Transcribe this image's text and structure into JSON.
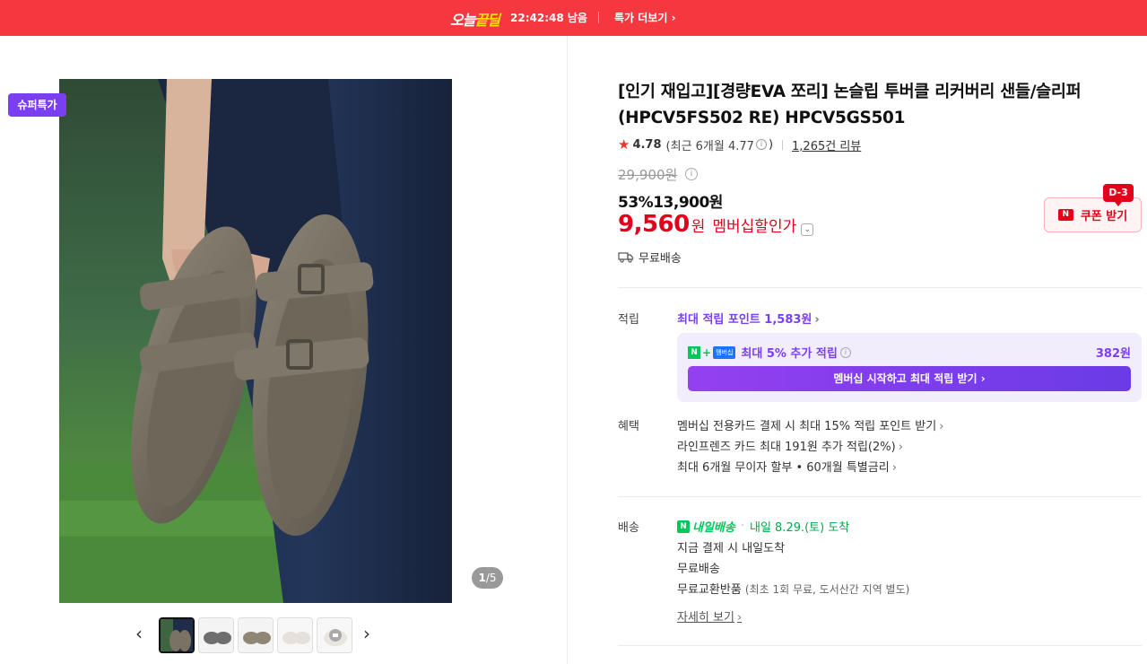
{
  "promo_bar": {
    "logo_white": "오늘",
    "logo_yellow": "끝딜",
    "countdown": "22:42:48",
    "countdown_suffix": "남음",
    "more_link": "특가 더보기"
  },
  "gallery": {
    "badge": "슈퍼특가",
    "pager_current": "1",
    "pager_total": "/5",
    "thumbnail_count": 5,
    "selected_thumbnail": 1
  },
  "product": {
    "title": "[인기 재입고][경량EVA 쪼리] 논슬립 투버클 리커버리 샌들/슬리퍼 (HPCV5FS502 RE) HPCV5GS501",
    "rating": "4.78",
    "recent_rating_label": "(최근 6개월 4.77",
    "recent_rating_close": ")",
    "reviews": "1,265건 리뷰",
    "original_price": "29,900원",
    "discount_rate": "53%",
    "sale_price": "13,900원",
    "member_price": "9,560",
    "member_price_unit": "원",
    "member_price_label": "멤버십할인가",
    "shipping_free": "무료배송"
  },
  "coupon": {
    "badge": "D-3",
    "n_mark": "N",
    "label": "쿠폰 받기"
  },
  "points": {
    "section_label": "적립",
    "max_points_link": "최대 적립 포인트 1,583원",
    "npay_n": "N",
    "npay_member": "멤버십",
    "extra_text": "최대 5% 추가 적립",
    "extra_amount": "382원",
    "cta": "멤버십 시작하고 최대 적립 받기"
  },
  "benefits": {
    "section_label": "혜택",
    "items": [
      "멤버십 전용카드 결제 시 최대 15% 적립 포인트 받기",
      "라인프렌즈 카드 최대 191원 추가 적립(2%)",
      "최대 6개월 무이자 할부 • 60개월 특별금리"
    ]
  },
  "delivery": {
    "section_label": "배송",
    "brand": "내일배송",
    "eta": "내일 8.29.(토) 도착",
    "lines": [
      "지금 결제 시 내일도착",
      "무료배송",
      "무료교환반품"
    ],
    "exchange_note": "(최초 1회 무료, 도서산간 지역 별도)",
    "detail_link": "자세히 보기"
  },
  "colors": {
    "promo_red": "#f5373f",
    "price_red": "#e3001b",
    "membership_purple": "#7b3ff2",
    "naver_green": "#03c75a"
  }
}
